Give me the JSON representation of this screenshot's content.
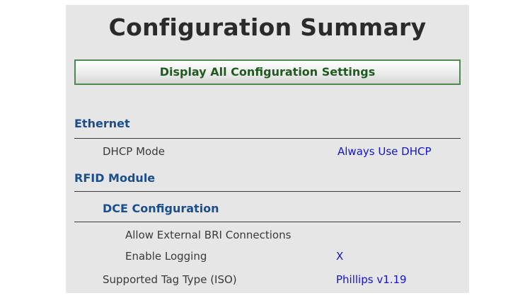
{
  "title": "Configuration Summary",
  "display_button_label": "Display All Configuration Settings",
  "ethernet": {
    "heading": "Ethernet",
    "dhcp_mode_label": "DHCP Mode",
    "dhcp_mode_value": "Always Use DHCP"
  },
  "rfid": {
    "heading": "RFID Module",
    "dce": {
      "heading": "DCE Configuration",
      "allow_external_bri_label": "Allow External BRI Connections",
      "enable_logging_label": "Enable Logging",
      "enable_logging_value": "X"
    },
    "supported_tag_label": "Supported Tag Type (ISO)",
    "supported_tag_value": "Phillips v1.19"
  },
  "colors": {
    "panel_bg": "#e6e6e6",
    "section_heading": "#1a4f8b",
    "value_text": "#1414cc",
    "button_border": "#4d8a4d",
    "button_text": "#1f5a1f"
  }
}
